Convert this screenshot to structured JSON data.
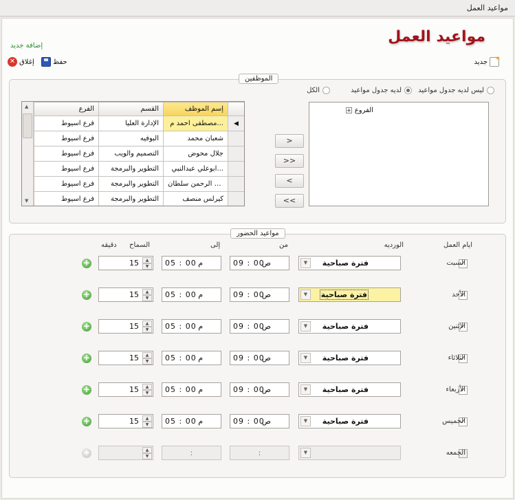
{
  "window": {
    "title": "مواعيد العمل"
  },
  "page": {
    "title": "مواعيد  العمل",
    "add_new": "إضافة جديد"
  },
  "toolbar": {
    "new_label": "جديد",
    "save_label": "حفظ",
    "close_label": "إغلاق"
  },
  "employees_group": {
    "legend": "الموظفين",
    "radios": [
      {
        "label": "ليس لديه جدول مواعيد",
        "selected": false
      },
      {
        "label": "لديه جدول مواعيد",
        "selected": true
      },
      {
        "label": "الكل",
        "selected": false
      }
    ],
    "tree_root": "الفروع",
    "move_buttons": [
      ">",
      ">>",
      "<",
      "<<"
    ],
    "grid": {
      "columns": [
        "إسم الموظف",
        "القسم",
        "الفرع"
      ],
      "rows": [
        [
          "مصطفى احمد م...",
          "الإدارة العليا",
          "فرع اسيوط"
        ],
        [
          "شعبان محمد",
          "البوفيه",
          "فرع اسيوط"
        ],
        [
          "جلال محوض",
          "التصميم والويب",
          "فرع اسيوط"
        ],
        [
          "ابوعلي عبدالنبي...",
          "التطوير والبرمجة",
          "فرع اسيوط"
        ],
        [
          "عبد الرحمن سلطان",
          "التطوير والبرمجة",
          "فرع اسيوط"
        ],
        [
          "كيرلس منصف",
          "التطوير والبرمجة",
          "فرع اسيوط"
        ]
      ]
    }
  },
  "attendance_group": {
    "legend": "مواعيد الحضور",
    "headers": {
      "days": "ايام العمل",
      "shift": "الورديه",
      "from": "من",
      "to": "إلى",
      "allowance": "السماح",
      "minutes": "دقيقه"
    },
    "rows": [
      {
        "day": "السبت",
        "checked": "✓",
        "shift": "فترة صباحية",
        "from": "09 : 00",
        "from_ampm": "ص",
        "to": "05 : 00",
        "to_ampm": "م",
        "allowance": "15"
      },
      {
        "day": "الأحد",
        "checked": "✓",
        "shift": "فترة صباحية",
        "from": "09 : 00",
        "from_ampm": "ص",
        "to": "05 : 00",
        "to_ampm": "م",
        "allowance": "15"
      },
      {
        "day": "الإثنين",
        "checked": "✓",
        "shift": "فترة صباحية",
        "from": "09 : 00",
        "from_ampm": "ص",
        "to": "05 : 00",
        "to_ampm": "م",
        "allowance": "15"
      },
      {
        "day": "الثلاثاء",
        "checked": "✓",
        "shift": "فترة صباحية",
        "from": "09 : 00",
        "from_ampm": "ص",
        "to": "05 : 00",
        "to_ampm": "م",
        "allowance": "15"
      },
      {
        "day": "الأربعاء",
        "checked": "✓",
        "shift": "فترة صباحية",
        "from": "09 : 00",
        "from_ampm": "ص",
        "to": "05 : 00",
        "to_ampm": "م",
        "allowance": "15"
      },
      {
        "day": "الخميس",
        "checked": "✓",
        "shift": "فترة صباحية",
        "from": "09 : 00",
        "from_ampm": "ص",
        "to": "05 : 00",
        "to_ampm": "م",
        "allowance": "15"
      },
      {
        "day": "الجمعه",
        "checked": "",
        "shift": "",
        "from": ":",
        "from_ampm": "",
        "to": ":",
        "to_ampm": "",
        "allowance": ""
      }
    ]
  }
}
